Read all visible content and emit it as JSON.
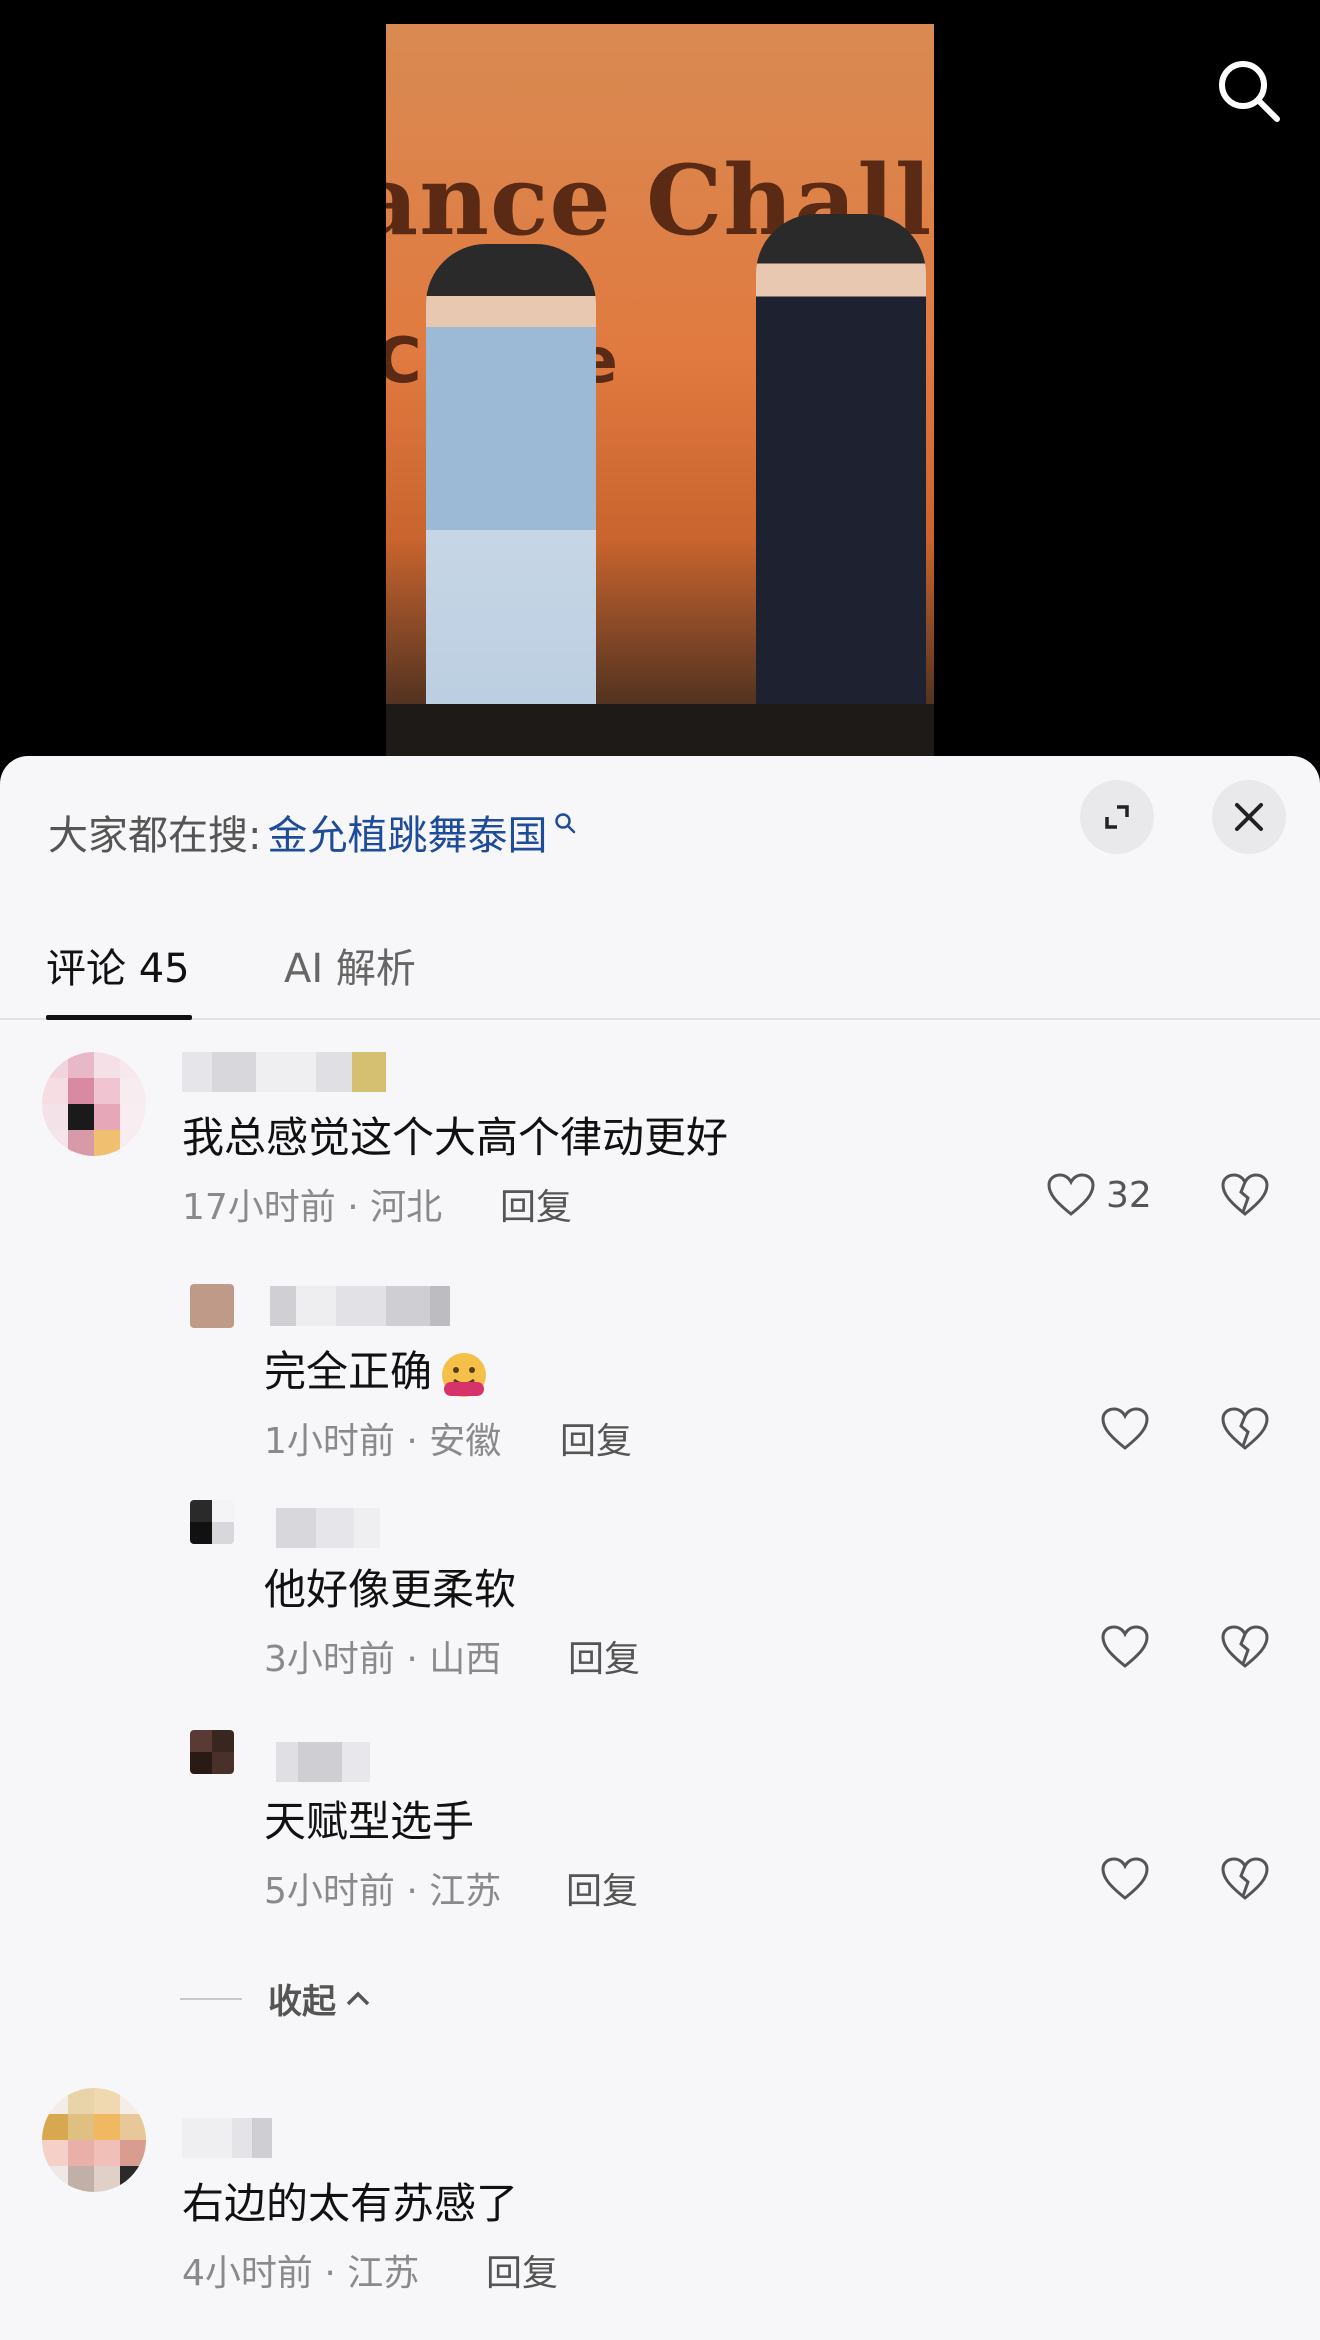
{
  "topbar": {
    "search_icon": "search-icon"
  },
  "video": {
    "stage_text_1": "ance Challeng",
    "stage_text_2": "Ch   nge"
  },
  "sheet": {
    "hot_search_prefix": "大家都在搜:",
    "hot_search_keyword": "金允植跳舞泰国",
    "expand_icon": "expand-icon",
    "close_icon": "close-icon"
  },
  "tabs": [
    {
      "label": "评论 45",
      "active": true
    },
    {
      "label": "AI 解析",
      "active": false
    }
  ],
  "comments": [
    {
      "text": "我总感觉这个大高个律动更好",
      "meta": "17小时前 · 河北",
      "reply": "回复",
      "likes": "32",
      "replies": [
        {
          "text": "完全正确",
          "meta": "1小时前 · 安徽",
          "reply": "回复"
        },
        {
          "text": "他好像更柔软",
          "meta": "3小时前 · 山西",
          "reply": "回复"
        },
        {
          "text": "天赋型选手",
          "meta": "5小时前 · 江苏",
          "reply": "回复"
        }
      ],
      "collapse_label": "收起"
    },
    {
      "text": "右边的太有苏感了",
      "meta": "4小时前 · 江苏",
      "reply": "回复"
    }
  ]
}
